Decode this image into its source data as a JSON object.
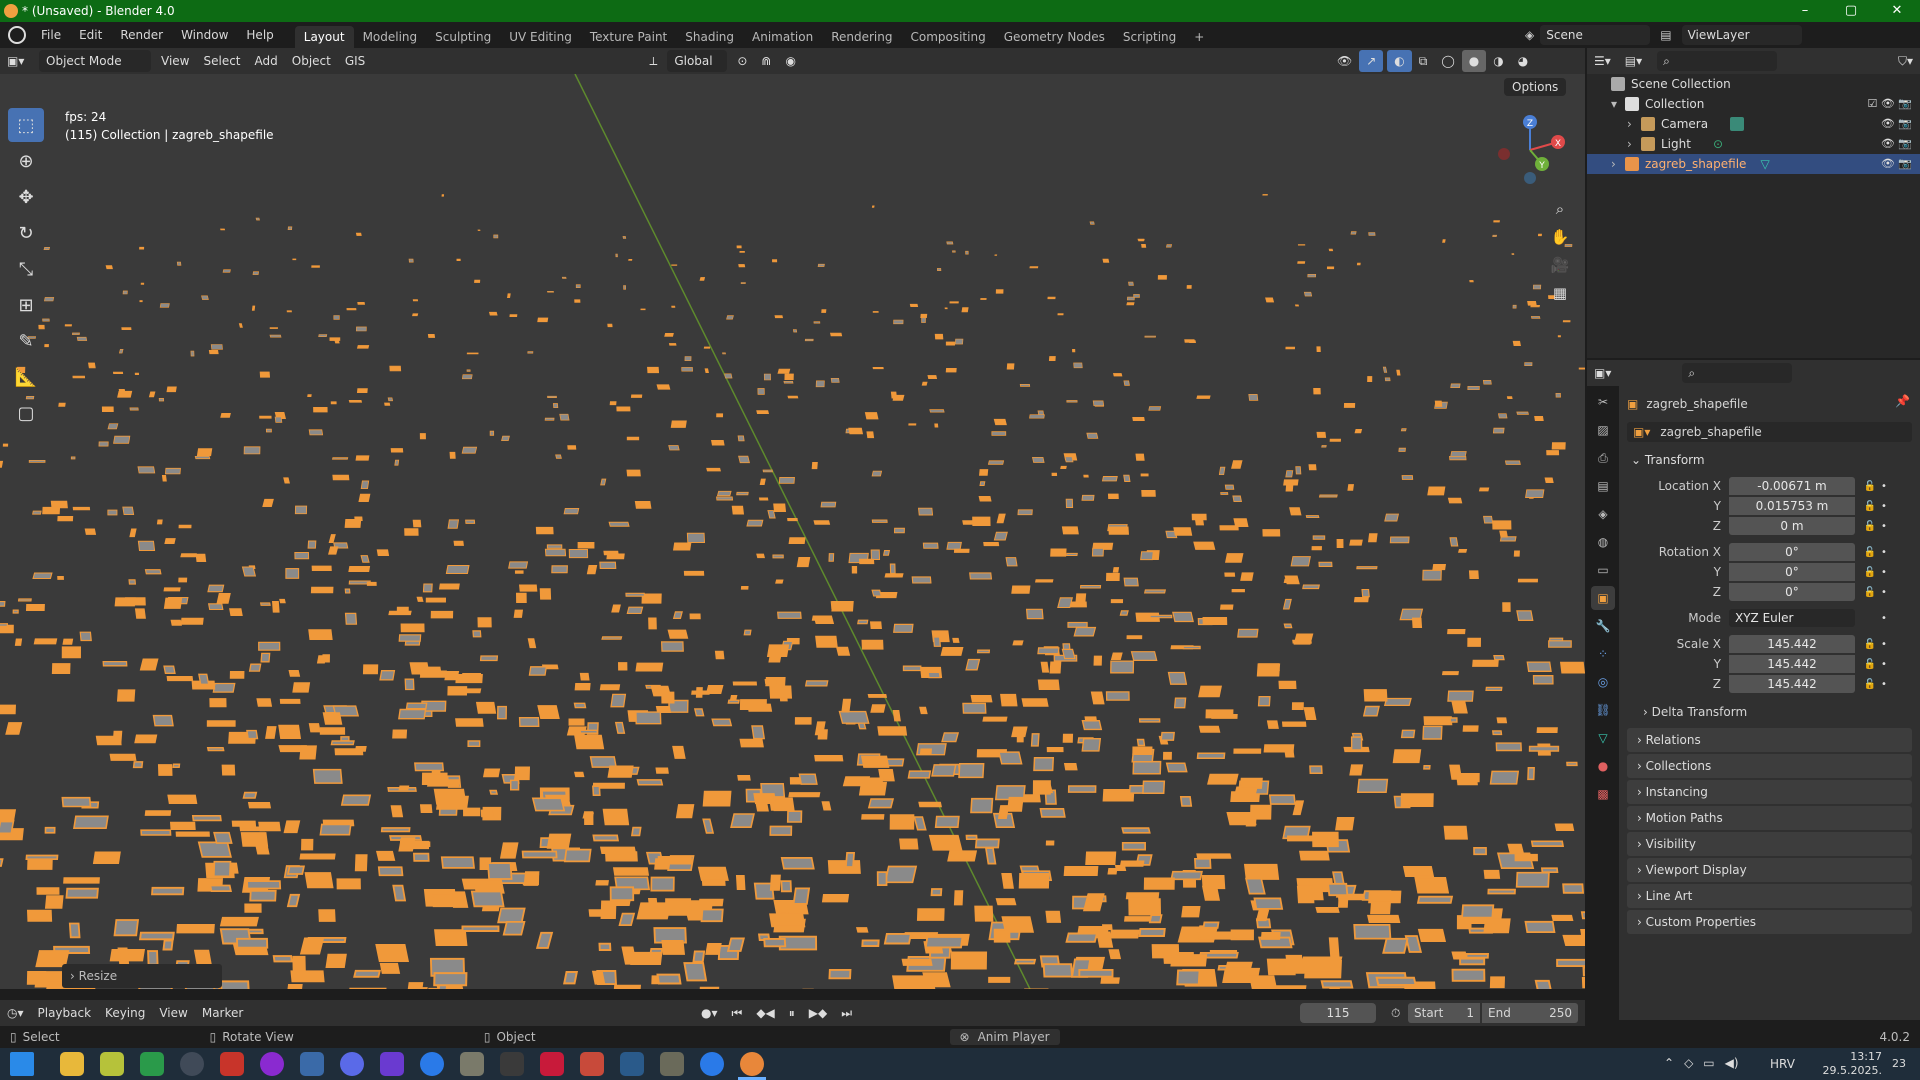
{
  "window": {
    "title": "* (Unsaved) - Blender 4.0",
    "minimize": "–",
    "maximize": "▢",
    "close": "✕"
  },
  "menus": [
    "File",
    "Edit",
    "Render",
    "Window",
    "Help"
  ],
  "workspaces": [
    "Layout",
    "Modeling",
    "Sculpting",
    "UV Editing",
    "Texture Paint",
    "Shading",
    "Animation",
    "Rendering",
    "Compositing",
    "Geometry Nodes",
    "Scripting"
  ],
  "active_workspace": "Layout",
  "add_workspace": "+",
  "scene": {
    "label": "Scene"
  },
  "viewlayer": {
    "label": "ViewLayer"
  },
  "viewport_header": {
    "mode": "Object Mode",
    "menus": [
      "View",
      "Select",
      "Add",
      "Object",
      "GIS"
    ],
    "orientation": "Global"
  },
  "viewport": {
    "fps_text": "fps: 24",
    "collection_text": "(115) Collection | zagreb_shapefile",
    "options_label": "Options",
    "resize_label": "Resize",
    "gizmo_labels": {
      "z": "Z",
      "x": "X",
      "y": "Y"
    },
    "colors": {
      "background": "#3a3a3a",
      "buildings": "#f0993a",
      "roofs": "#8a8a8a",
      "axis_y": "#5e8a2d"
    }
  },
  "outliner": {
    "items": [
      {
        "label": "Scene Collection",
        "indent": 0
      },
      {
        "label": "Collection",
        "indent": 1
      },
      {
        "label": "Camera",
        "indent": 2
      },
      {
        "label": "Light",
        "indent": 2
      },
      {
        "label": "zagreb_shapefile",
        "indent": 1,
        "selected": true
      }
    ]
  },
  "properties": {
    "object_name": "zagreb_shapefile",
    "data_name": "zagreb_shapefile",
    "transform_header": "Transform",
    "location": {
      "label_x": "Location X",
      "x": "-0.00671 m",
      "label_y": "Y",
      "y": "0.015753 m",
      "label_z": "Z",
      "z": "0 m"
    },
    "rotation": {
      "label_x": "Rotation X",
      "x": "0°",
      "label_y": "Y",
      "y": "0°",
      "label_z": "Z",
      "z": "0°"
    },
    "mode": {
      "label": "Mode",
      "value": "XYZ Euler"
    },
    "scale": {
      "label_x": "Scale X",
      "x": "145.442",
      "label_y": "Y",
      "y": "145.442",
      "label_z": "Z",
      "z": "145.442"
    },
    "delta_transform": "Delta Transform",
    "panels": [
      "Relations",
      "Collections",
      "Instancing",
      "Motion Paths",
      "Visibility",
      "Viewport Display",
      "Line Art",
      "Custom Properties"
    ]
  },
  "timeline": {
    "menus": [
      "Playback",
      "Keying",
      "View",
      "Marker"
    ],
    "current_frame": "115",
    "start_label": "Start",
    "start": "1",
    "end_label": "End",
    "end": "250"
  },
  "statusbar": {
    "select": "Select",
    "rotate": "Rotate View",
    "object": "Object",
    "anim_player": "Anim Player",
    "version": "4.0.2"
  },
  "taskbar": {
    "lang": "HRV",
    "time": "13:17",
    "date": "29.5.2025.",
    "notifications": "23"
  }
}
